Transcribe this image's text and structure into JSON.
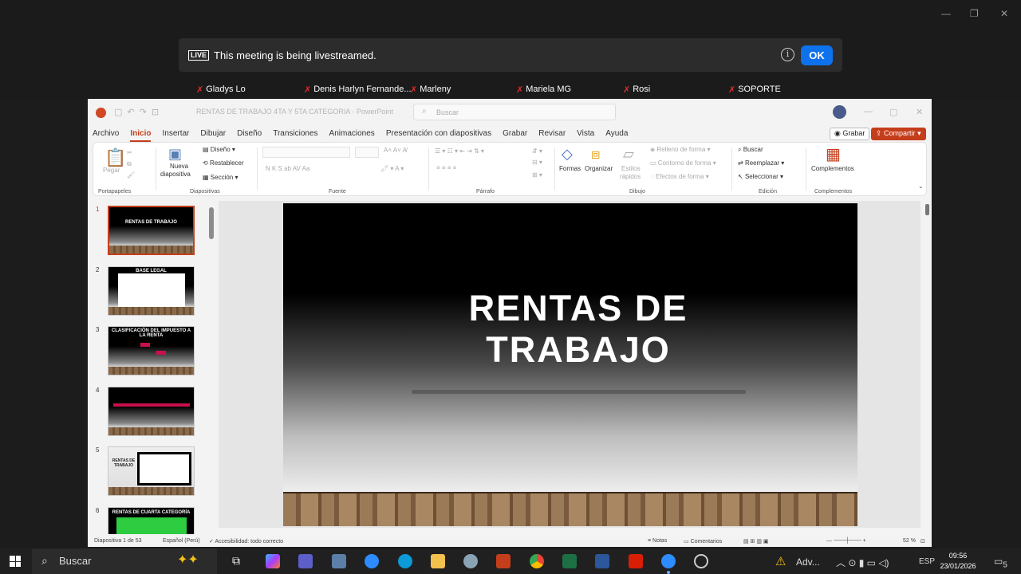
{
  "banner": {
    "live_badge": "LIVE",
    "message": "This meeting is being livestreamed.",
    "ok_label": "OK",
    "info_glyph": "i"
  },
  "participants": [
    {
      "name": "Gladys Lo"
    },
    {
      "name": "Denis Harlyn Fernande..."
    },
    {
      "name": "Marleny"
    },
    {
      "name": "Mariela MG"
    },
    {
      "name": "Rosi"
    },
    {
      "name": "SOPORTE"
    }
  ],
  "ppt": {
    "doc_title": "RENTAS DE TRABAJO 4TA Y 5TA CATEGORIA  -  PowerPoint",
    "search_placeholder": "Buscar",
    "menus": [
      "Archivo",
      "Inicio",
      "Insertar",
      "Dibujar",
      "Diseño",
      "Transiciones",
      "Animaciones",
      "Presentación con diapositivas",
      "Grabar",
      "Revisar",
      "Vista",
      "Ayuda"
    ],
    "active_menu": "Inicio",
    "grabar": "Grabar",
    "compartir": "Compartir",
    "ribbon": {
      "pegar": "Pegar",
      "portapapeles": "Portapapeles",
      "nueva1": "Nueva",
      "nueva2": "diapositiva",
      "diseno": "Diseño",
      "restablecer": "Restablecer",
      "seccion": "Sección",
      "diapositivas": "Diapositivas",
      "fuente": "Fuente",
      "parrafo": "Párrafo",
      "formas": "Formas",
      "organizar": "Organizar",
      "estilos1": "Estilos",
      "estilos2": "rápidos",
      "relleno": "Relleno de forma",
      "contorno": "Contorno de forma",
      "efectos": "Efectos de forma",
      "dibujo": "Dibujo",
      "buscar": "Buscar",
      "reemplazar": "Reemplazar",
      "seleccionar": "Seleccionar",
      "edicion": "Edición",
      "complementos": "Complementos",
      "complementos_group": "Complementos",
      "font_glyphs": "N   K   S   ab   AV   Aa",
      "para_glyphs": "≡  ≡  ≡  ≡"
    },
    "thumbs": [
      {
        "num": "1",
        "title": "RENTAS DE TRABAJO"
      },
      {
        "num": "2",
        "title": "BASE LEGAL"
      },
      {
        "num": "3",
        "title": "CLASIFICACIÓN DEL IMPUESTO A LA RENTA"
      },
      {
        "num": "4",
        "title": ""
      },
      {
        "num": "5",
        "title": "RENTAS DE TRABAJO"
      },
      {
        "num": "6",
        "title": "RENTAS DE CUARTA CATEGORÍA"
      }
    ],
    "slide_title_line1": "RENTAS DE",
    "slide_title_line2": "TRABAJO",
    "status": {
      "slide_count": "Diapositiva 1 de 53",
      "language": "Español (Perú)",
      "accessibility": "Accesibilidad: todo correcto",
      "notes": "Notas",
      "comments": "Comentarios",
      "zoom": "52 %"
    }
  },
  "taskbar": {
    "search": "Buscar",
    "weather": "Adv...",
    "lang": "ESP",
    "time": "09:56",
    "date": "23/01/2026",
    "notif_count": "5"
  },
  "colors": {
    "accent": "#c43e1c",
    "zoom_blue": "#0e72ed"
  }
}
